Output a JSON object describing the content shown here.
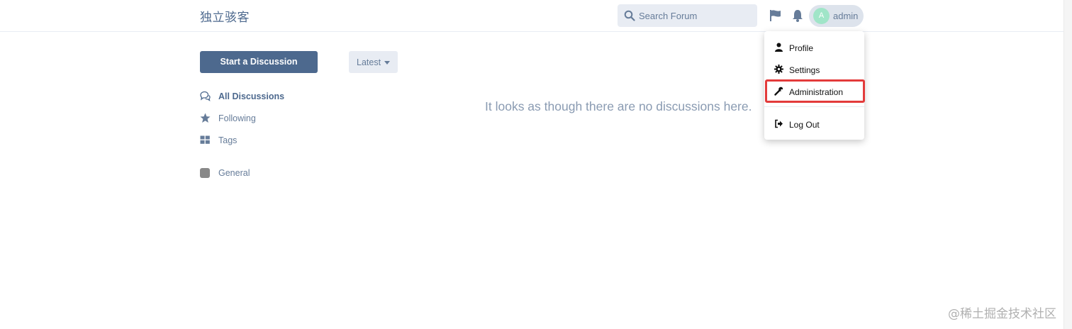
{
  "header": {
    "brand": "独立骇客",
    "search_placeholder": "Search Forum",
    "user": {
      "avatar_letter": "A",
      "name": "admin"
    }
  },
  "user_menu": {
    "items": [
      {
        "label": "Profile",
        "icon": "user-icon"
      },
      {
        "label": "Settings",
        "icon": "gear-icon"
      },
      {
        "label": "Administration",
        "icon": "wrench-icon"
      },
      {
        "label": "Log Out",
        "icon": "sign-out-icon"
      }
    ]
  },
  "sidebar": {
    "start_button": "Start a Discussion",
    "nav": [
      {
        "label": "All Discussions",
        "icon": "comments-icon"
      },
      {
        "label": "Following",
        "icon": "star-icon"
      },
      {
        "label": "Tags",
        "icon": "grid-icon"
      },
      {
        "label": "General",
        "icon": "tag-square-icon"
      }
    ]
  },
  "toolbar": {
    "sort_label": "Latest"
  },
  "main": {
    "empty_message": "It looks as though there are no discussions here."
  },
  "watermark": "@稀土掘金技术社区",
  "colors": {
    "primary": "#4d698e",
    "muted": "#667c99",
    "highlight": "#e33b3b"
  }
}
